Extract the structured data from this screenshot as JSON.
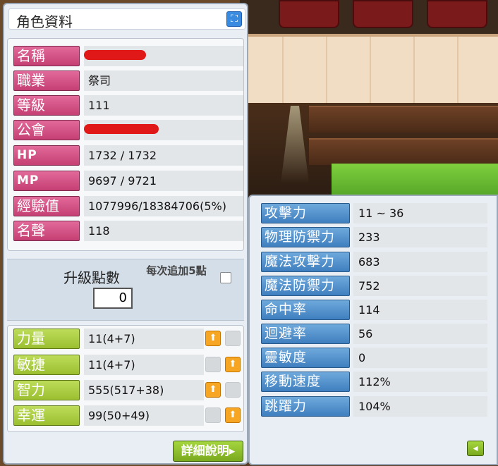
{
  "character_panel": {
    "title": "角色資料",
    "rows": [
      {
        "label": "名稱",
        "value": ""
      },
      {
        "label": "職業",
        "value": "祭司"
      },
      {
        "label": "等級",
        "value": "111"
      },
      {
        "label": "公會",
        "value": ""
      },
      {
        "label": "HP",
        "value": "1732 / 1732"
      },
      {
        "label": "MP",
        "value": "9697 / 9721"
      },
      {
        "label": "經驗值",
        "value": "1077996/18384706(5%)"
      },
      {
        "label": "名聲",
        "value": "118"
      }
    ],
    "ability_points": {
      "label": "升級點數",
      "value": "0",
      "per5_label": "每次追加5點"
    },
    "stats": [
      {
        "label": "力量",
        "value": "11(4+7)",
        "up_slot": "left"
      },
      {
        "label": "敏捷",
        "value": "11(4+7)",
        "up_slot": "right"
      },
      {
        "label": "智力",
        "value": "555(517+38)",
        "up_slot": "left"
      },
      {
        "label": "幸運",
        "value": "99(50+49)",
        "up_slot": "right"
      }
    ],
    "detail_button": "詳細說明▸"
  },
  "detail_panel": {
    "rows": [
      {
        "label": "攻擊力",
        "value": "11 ~ 36"
      },
      {
        "label": "物理防禦力",
        "value": "233"
      },
      {
        "label": "魔法攻擊力",
        "value": "683"
      },
      {
        "label": "魔法防禦力",
        "value": "752"
      },
      {
        "label": "命中率",
        "value": "114"
      },
      {
        "label": "迴避率",
        "value": "56"
      },
      {
        "label": "靈敏度",
        "value": "0"
      },
      {
        "label": "移動速度",
        "value": "112%"
      },
      {
        "label": "跳躍力",
        "value": "104%"
      }
    ],
    "back_icon": "arrow-left-icon"
  },
  "colors": {
    "info_label": "#d4548a",
    "stat_label": "#a9cc3c",
    "detail_label": "#5a96d0",
    "up_button": "#f6a623",
    "redaction": "#e01818"
  }
}
